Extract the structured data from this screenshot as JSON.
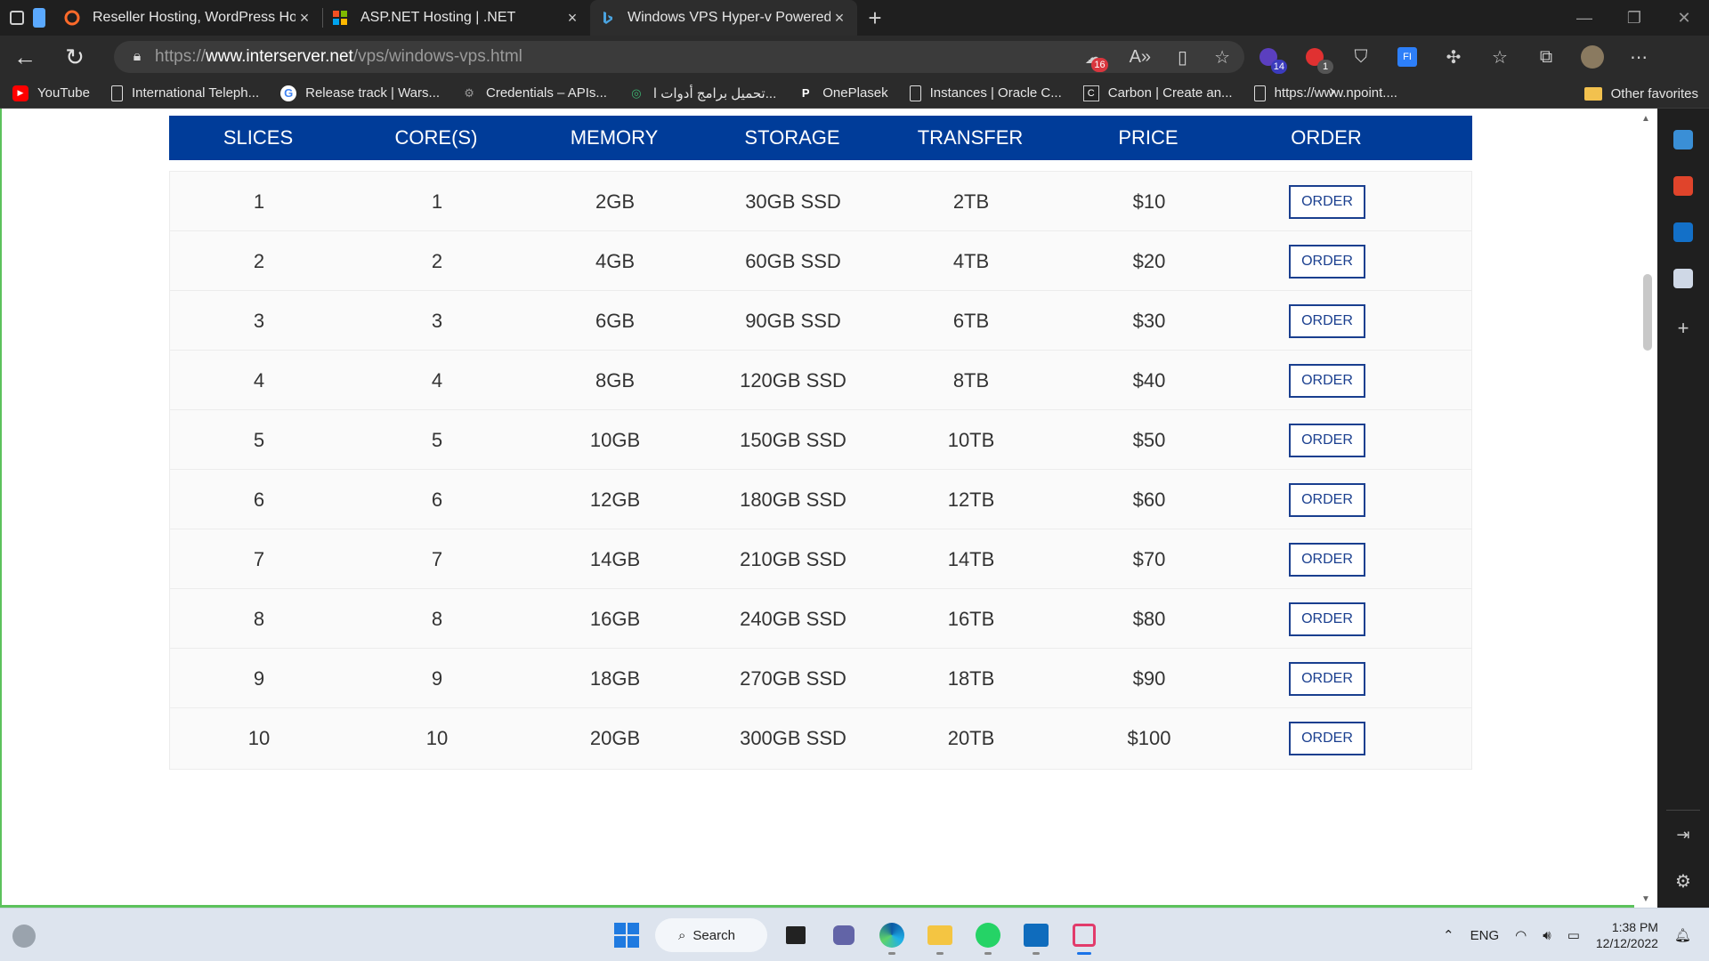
{
  "browser": {
    "tabs": [
      {
        "label": "Reseller Hosting, WordPress Host",
        "active": false
      },
      {
        "label": "ASP.NET Hosting | .NET",
        "active": false
      },
      {
        "label": "Windows VPS Hyper-v Powered |",
        "active": true
      }
    ],
    "url_prefix": "https://",
    "url_domain": "www.interserver.net",
    "url_path": "/vps/windows-vps.html",
    "extension_badges": {
      "a": "16",
      "b": "14",
      "c": "1"
    },
    "ext_label": "FI"
  },
  "favorites": {
    "items": [
      "YouTube",
      "International Teleph...",
      "Release track | Wars...",
      "Credentials – APIs...",
      "تحميل برامج أدوات ا...",
      "OnePlasek",
      "Instances | Oracle C...",
      "Carbon | Create an...",
      "https://www.npoint...."
    ],
    "other": "Other favorites"
  },
  "table": {
    "headers": [
      "SLICES",
      "CORE(S)",
      "MEMORY",
      "STORAGE",
      "TRANSFER",
      "PRICE",
      "ORDER"
    ],
    "order_label": "ORDER",
    "rows": [
      [
        "1",
        "1",
        "2GB",
        "30GB SSD",
        "2TB",
        "$10"
      ],
      [
        "2",
        "2",
        "4GB",
        "60GB SSD",
        "4TB",
        "$20"
      ],
      [
        "3",
        "3",
        "6GB",
        "90GB SSD",
        "6TB",
        "$30"
      ],
      [
        "4",
        "4",
        "8GB",
        "120GB SSD",
        "8TB",
        "$40"
      ],
      [
        "5",
        "5",
        "10GB",
        "150GB SSD",
        "10TB",
        "$50"
      ],
      [
        "6",
        "6",
        "12GB",
        "180GB SSD",
        "12TB",
        "$60"
      ],
      [
        "7",
        "7",
        "14GB",
        "210GB SSD",
        "14TB",
        "$70"
      ],
      [
        "8",
        "8",
        "16GB",
        "240GB SSD",
        "16TB",
        "$80"
      ],
      [
        "9",
        "9",
        "18GB",
        "270GB SSD",
        "18TB",
        "$90"
      ],
      [
        "10",
        "10",
        "20GB",
        "300GB SSD",
        "20TB",
        "$100"
      ]
    ]
  },
  "taskbar": {
    "search_label": "Search",
    "language": "ENG",
    "time": "1:38 PM",
    "date": "12/12/2022"
  },
  "colors": {
    "header_blue": "#003c99",
    "order_border": "#1a3f8f",
    "chat_blue": "#1a73e8"
  }
}
